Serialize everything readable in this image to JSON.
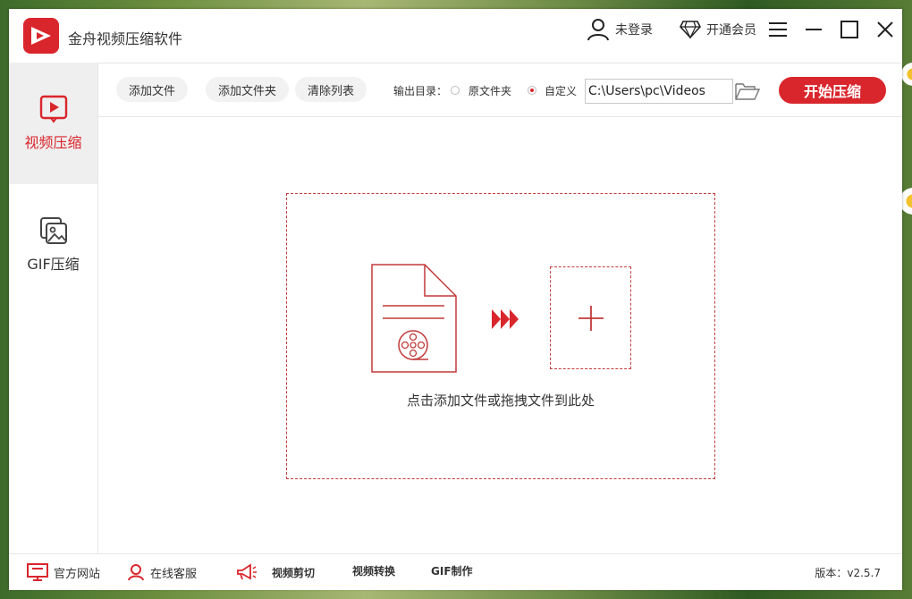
{
  "app": {
    "title": "金舟视频压缩软件"
  },
  "titlebar": {
    "login_label": "未登录",
    "vip_label": "开通会员",
    "icons": {
      "user": "user-icon",
      "vip": "diamond-icon",
      "menu": "hamburger-icon",
      "minimize": "minimize-icon",
      "maximize": "maximize-icon",
      "close": "close-icon"
    }
  },
  "sidebar": {
    "items": [
      {
        "label": "视频压缩",
        "icon": "video-play-icon",
        "active": true
      },
      {
        "label": "GIF压缩",
        "icon": "image-stack-icon",
        "active": false
      }
    ]
  },
  "toolbar": {
    "add_file": "添加文件",
    "add_folder": "添加文件夹",
    "clear_list": "清除列表",
    "output_label": "输出目录：",
    "radio_original": "原文件夹",
    "radio_custom": "自定义",
    "selected_output": "自定义",
    "output_path": "C:\\Users\\pc\\Videos",
    "start_button": "开始压缩"
  },
  "dropzone": {
    "hint": "点击添加文件或拖拽文件到此处"
  },
  "footer": {
    "official_site": "官方网站",
    "online_service": "在线客服",
    "video_cut": "视频剪切",
    "video_convert": "视频转换",
    "gif_make": "GIF制作",
    "version": "版本：v2.5.7"
  },
  "colors": {
    "accent": "#d9262c",
    "border": "#e6e6e6",
    "active_bg": "#efefef"
  }
}
